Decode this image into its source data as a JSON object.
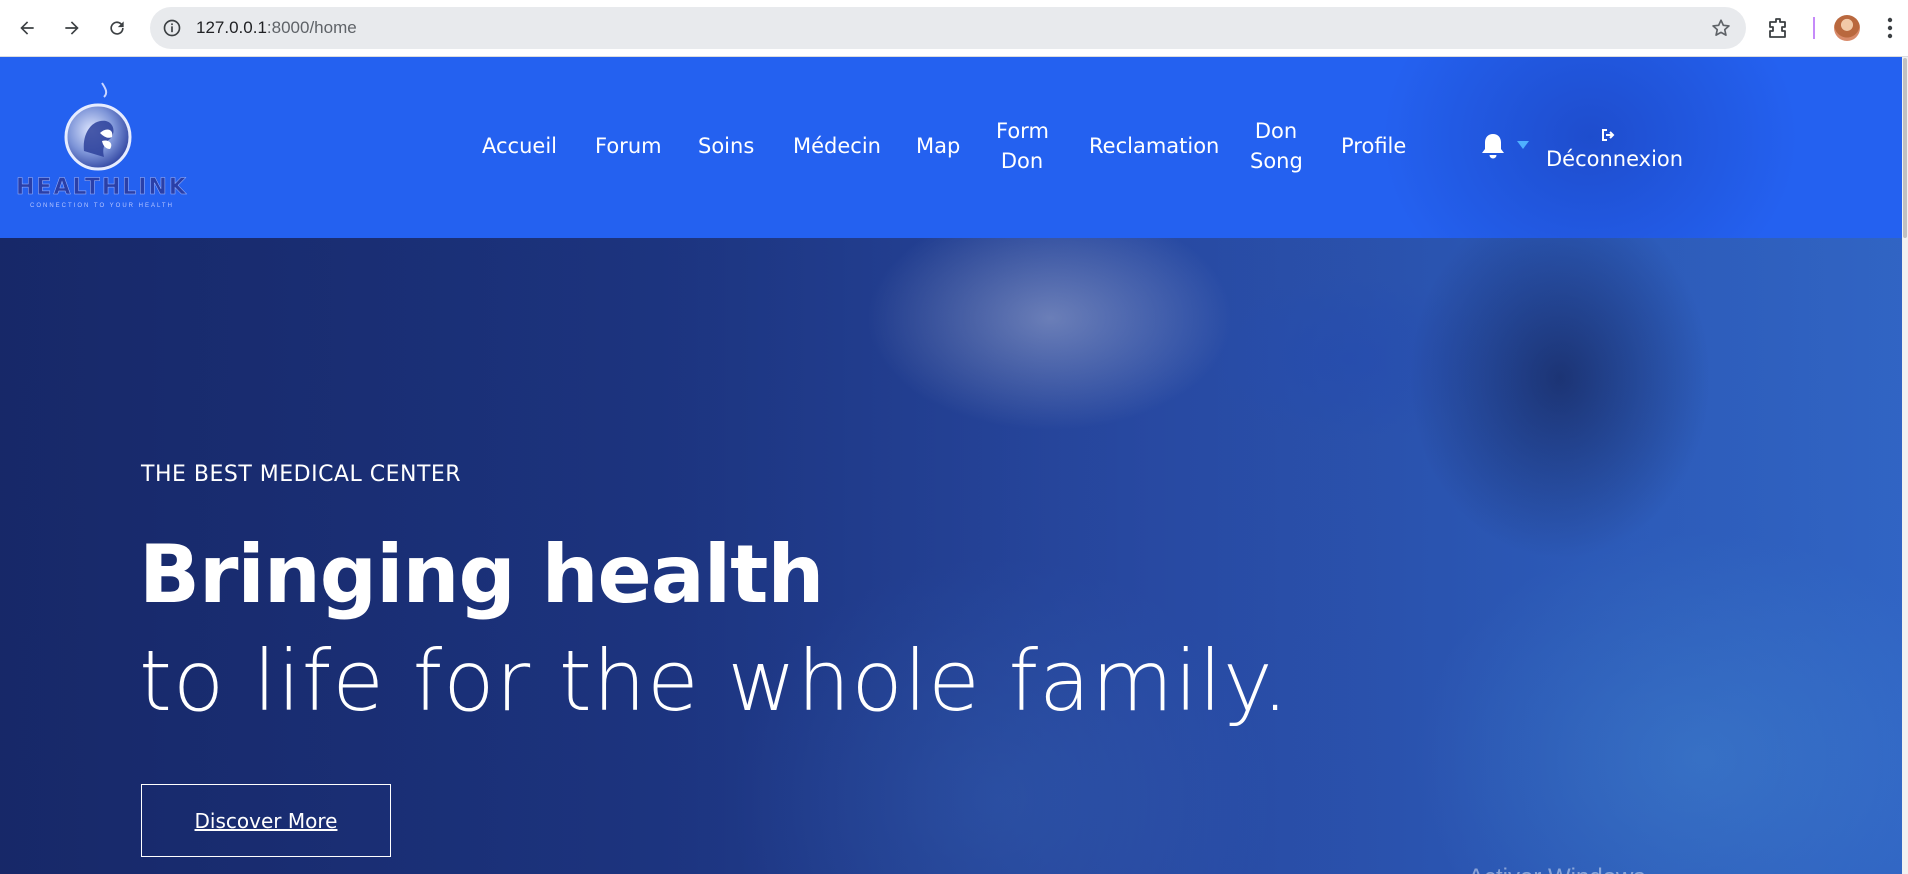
{
  "browser": {
    "url_host": "127.0.0.1",
    "url_path": ":8000/home"
  },
  "site": {
    "logo_text": "HEALTHLINK",
    "logo_tagline": "CONNECTION TO YOUR HEALTH",
    "nav": [
      {
        "label": "Accueil"
      },
      {
        "label": "Forum"
      },
      {
        "label": "Soins"
      },
      {
        "label": "Médecin"
      },
      {
        "label": "Map"
      },
      {
        "label": "Form\nDon"
      },
      {
        "label": "Reclamation"
      },
      {
        "label": "Don\nSong"
      },
      {
        "label": "Profile"
      }
    ],
    "logout_label": "Déconnexion",
    "colors": {
      "header_bg": "#2461f0",
      "caret": "#4fb0ff"
    }
  },
  "hero": {
    "eyebrow": "THE BEST MEDICAL CENTER",
    "title_bold": "Bringing health",
    "title_light": "to life for the whole family.",
    "cta_label": "Discover More",
    "watermark": "Activer Windows"
  }
}
